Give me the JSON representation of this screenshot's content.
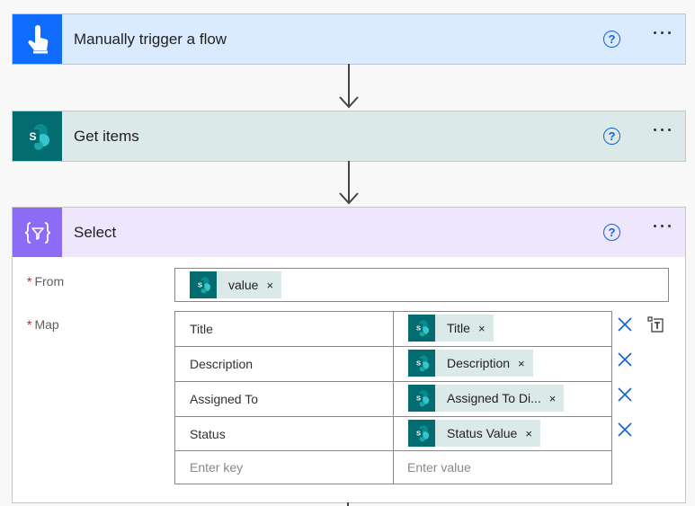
{
  "steps": {
    "trigger": {
      "title": "Manually trigger a flow",
      "icon": "touch-icon",
      "color": "#0f6cff"
    },
    "get_items": {
      "title": "Get items",
      "icon": "sharepoint-icon",
      "color": "#036c70"
    },
    "select": {
      "title": "Select",
      "icon": "data-operation-icon",
      "color": "#8c6cf4"
    }
  },
  "help_glyph": "?",
  "select_form": {
    "required_marker": "*",
    "from_label": "From",
    "map_label": "Map",
    "from_token": {
      "label": "value",
      "remove": "×"
    },
    "map_rows": [
      {
        "key": "Title",
        "token": "Title",
        "remove": "×"
      },
      {
        "key": "Description",
        "token": "Description",
        "remove": "×"
      },
      {
        "key": "Assigned To",
        "token": "Assigned To Di...",
        "remove": "×"
      },
      {
        "key": "Status",
        "token": "Status Value",
        "remove": "×"
      }
    ],
    "new_row": {
      "key_placeholder": "Enter key",
      "value_placeholder": "Enter value"
    }
  }
}
